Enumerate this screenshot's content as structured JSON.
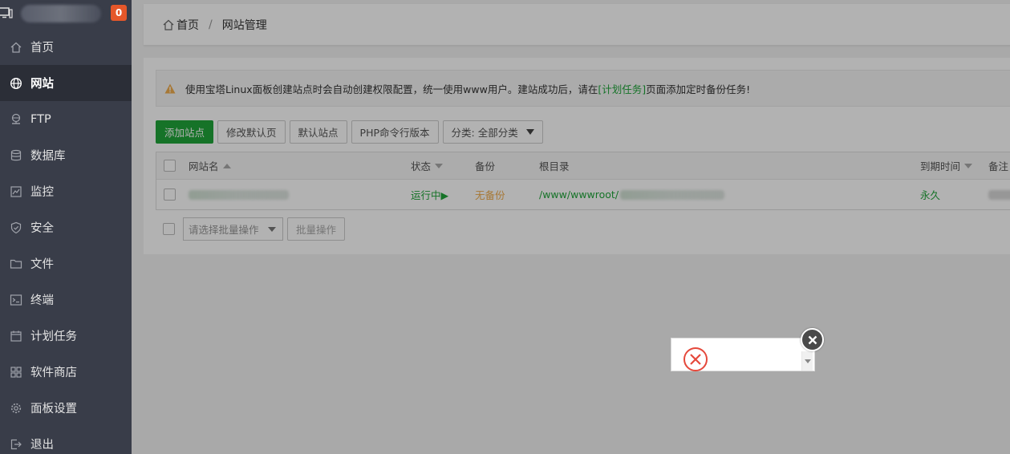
{
  "header": {
    "badge_count": "0"
  },
  "sidebar": {
    "items": [
      {
        "label": "首页",
        "icon": "home-icon",
        "active": false
      },
      {
        "label": "网站",
        "icon": "globe-icon",
        "active": true
      },
      {
        "label": "FTP",
        "icon": "ftp-icon",
        "active": false
      },
      {
        "label": "数据库",
        "icon": "database-icon",
        "active": false
      },
      {
        "label": "监控",
        "icon": "monitor-icon",
        "active": false
      },
      {
        "label": "安全",
        "icon": "shield-icon",
        "active": false
      },
      {
        "label": "文件",
        "icon": "folder-icon",
        "active": false
      },
      {
        "label": "终端",
        "icon": "terminal-icon",
        "active": false
      },
      {
        "label": "计划任务",
        "icon": "calendar-icon",
        "active": false
      },
      {
        "label": "软件商店",
        "icon": "apps-icon",
        "active": false
      },
      {
        "label": "面板设置",
        "icon": "gear-icon",
        "active": false
      },
      {
        "label": "退出",
        "icon": "logout-icon",
        "active": false
      }
    ]
  },
  "breadcrumb": {
    "home": "首页",
    "separator": "/",
    "current": "网站管理"
  },
  "notice": {
    "text_before": "使用宝塔Linux面板创建站点时会自动创建权限配置，统一使用www用户。建站成功后，请在",
    "link": "[计划任务]",
    "text_after": "页面添加定时备份任务!"
  },
  "toolbar": {
    "add_site": "添加站点",
    "edit_default_page": "修改默认页",
    "default_site": "默认站点",
    "php_cli_version": "PHP命令行版本",
    "category": "分类: 全部分类"
  },
  "table": {
    "headers": {
      "site_name": "网站名",
      "status": "状态",
      "backup": "备份",
      "root_dir": "根目录",
      "expire": "到期时间",
      "remark": "备注"
    },
    "rows": [
      {
        "site_name": "",
        "status": "运行中▶",
        "backup": "无备份",
        "root_dir": "/www/wwwroot/",
        "expire": "永久",
        "remark": ""
      }
    ]
  },
  "batch": {
    "placeholder": "请选择批量操作",
    "button": "批量操作"
  },
  "colors": {
    "sidebar_bg": "#393d49",
    "accent_green": "#20a53a",
    "warning_orange": "#f0ad4e",
    "badge_orange": "#e5572a",
    "error_red": "#e5483b"
  }
}
